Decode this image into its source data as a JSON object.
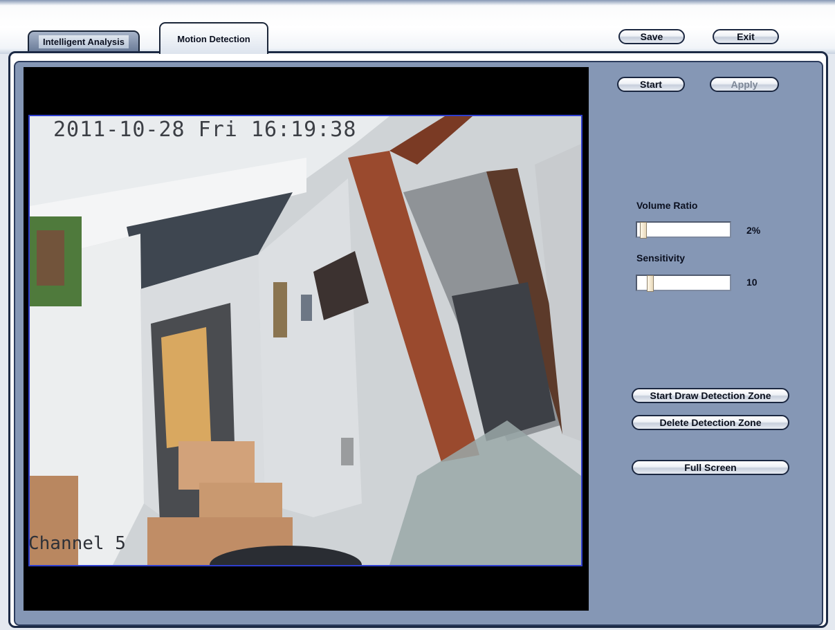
{
  "tabs": [
    {
      "label": "Intelligent Analysis",
      "active": false
    },
    {
      "label": "Motion Detection",
      "active": true
    }
  ],
  "header_buttons": {
    "save": "Save",
    "exit": "Exit"
  },
  "controls": {
    "start": "Start",
    "apply": "Apply",
    "apply_enabled": false
  },
  "video": {
    "timestamp": "2011-10-28 Fri 16:19:38",
    "channel": "Channel 5"
  },
  "volume_ratio": {
    "label": "Volume Ratio",
    "value_text": "2%",
    "value": 2,
    "min": 0,
    "max": 100
  },
  "sensitivity": {
    "label": "Sensitivity",
    "value_text": "10",
    "value": 10,
    "min": 0,
    "max": 100
  },
  "zone_buttons": {
    "start_draw": "Start Draw Detection Zone",
    "delete": "Delete Detection Zone",
    "full_screen": "Full Screen"
  },
  "colors": {
    "panel": "#8597b5",
    "frame": "#1c2a45",
    "video_border": "#2f3fd0"
  }
}
